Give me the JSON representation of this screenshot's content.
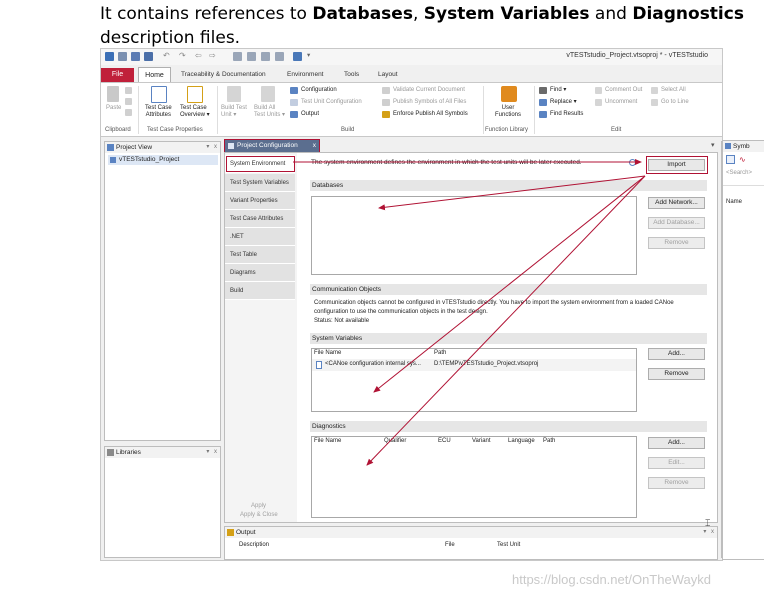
{
  "caption": {
    "part1": "It contains references to ",
    "databases": "Databases",
    "comma": ", ",
    "sysvars": "System Variables",
    "and": " and ",
    "diagnostics": "Diagnostics",
    "part2": "description files."
  },
  "window": {
    "title": "vTESTstudio_Project.vtsoproj * - vTESTstudio"
  },
  "menu": {
    "file": "File",
    "home": "Home",
    "traceability": "Traceability & Documentation",
    "environment": "Environment",
    "tools": "Tools",
    "layout": "Layout"
  },
  "ribbon": {
    "paste": "Paste",
    "test_case_attributes": [
      "Test Case",
      "Attributes"
    ],
    "test_case_overview": [
      "Test Case",
      "Overview ▾"
    ],
    "build_test_unit": [
      "Build Test",
      "Unit ▾"
    ],
    "build_all_test_units": [
      "Build All",
      "Test Units ▾"
    ],
    "configuration": "Configuration",
    "test_unit_configuration": "Test Unit Configuration",
    "output": "Output",
    "validate_current_document": "Validate Current Document",
    "publish_symbols": "Publish Symbols of All Files",
    "enforce_publish": "Enforce Publish All Symbols",
    "user_functions": [
      "User",
      "Functions"
    ],
    "find": "Find ▾",
    "replace": "Replace ▾",
    "find_results": "Find Results",
    "comment_out": "Comment Out",
    "uncomment": "Uncomment",
    "select_all": "Select All",
    "go_to_line": "Go to Line",
    "groups": {
      "clipboard": "Clipboard",
      "test_case_properties": "Test Case Properties",
      "build": "Build",
      "function_library": "Function Library",
      "edit": "Edit"
    }
  },
  "project_view": {
    "header": "Project View",
    "item": "vTESTstudio_Project",
    "controls": "▾  x"
  },
  "libraries": {
    "header": "Libraries",
    "controls": "▾  x"
  },
  "config_tab": {
    "label": "Project Configuration",
    "close": "x"
  },
  "symbols": {
    "header": "Symb",
    "search_placeholder": "<Search>",
    "name_col": "Name"
  },
  "nav": [
    "System Environment",
    "Test System Variables",
    "Variant Properties",
    "Test Case Attributes",
    ".NET",
    "Test Table",
    "Diagrams",
    "Build"
  ],
  "apply": {
    "apply": "Apply",
    "apply_close": "Apply & Close"
  },
  "system_env": {
    "description": "The system environment defines the environment in which the test units will be later executed.",
    "import": "Import"
  },
  "databases": {
    "header": "Databases",
    "add_network": "Add Network...",
    "add_database": "Add Database...",
    "remove": "Remove"
  },
  "comm_objects": {
    "header": "Communication Objects",
    "line1": "Communication objects cannot be configured in vTESTstudio directly.  You have to import the system environment from a loaded CANoe",
    "line2": "configuration to use the communication objects in the test design.",
    "status": "Status:  Not available"
  },
  "system_variables": {
    "header": "System Variables",
    "col_file_name": "File Name",
    "col_path": "Path",
    "row_name": "<CANoe configuration internal sys...",
    "row_path": "D:\\TEMP\\vTESTstudio_Project.vtsoproj",
    "add": "Add...",
    "remove": "Remove"
  },
  "diagnostics": {
    "header": "Diagnostics",
    "columns": [
      "File Name",
      "Qualifier",
      "ECU",
      "Variant",
      "Language",
      "Path"
    ],
    "add": "Add...",
    "edit": "Edit...",
    "remove": "Remove"
  },
  "output_pane": {
    "header": "Output",
    "columns": [
      "Description",
      "File",
      "Test Unit"
    ],
    "controls": "▾  x"
  },
  "watermark": "https://blog.csdn.net/OnTheWaykd",
  "colors": {
    "accent_red": "#b01234",
    "file_tab": "#c0203a"
  }
}
